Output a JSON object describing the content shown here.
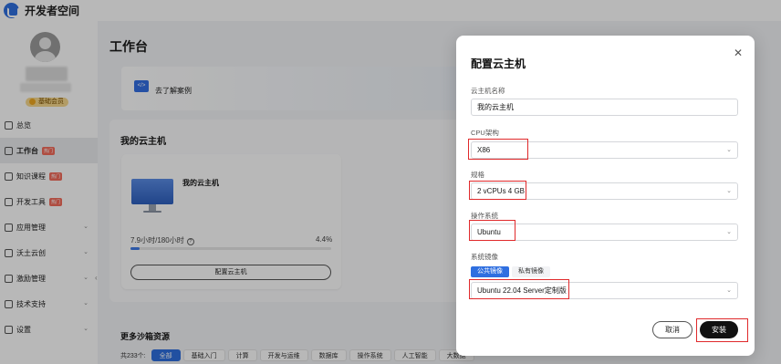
{
  "app": {
    "title": "开发者空间"
  },
  "sidebar": {
    "member_badge": "基础会员",
    "items": [
      {
        "label": "总览",
        "icon": "overview-icon",
        "tag": "",
        "chevron": false,
        "active": false
      },
      {
        "label": "工作台",
        "icon": "workbench-icon",
        "tag": "热门",
        "chevron": false,
        "active": true
      },
      {
        "label": "知识课程",
        "icon": "course-icon",
        "tag": "热门",
        "chevron": false,
        "active": false
      },
      {
        "label": "开发工具",
        "icon": "tools-icon",
        "tag": "热门",
        "chevron": false,
        "active": false
      },
      {
        "label": "应用管理",
        "icon": "app-icon",
        "tag": "",
        "chevron": true,
        "active": false
      },
      {
        "label": "沃土云创",
        "icon": "cloud-create-icon",
        "tag": "",
        "chevron": true,
        "active": false
      },
      {
        "label": "激励管理",
        "icon": "incentive-icon",
        "tag": "",
        "chevron": true,
        "active": false
      },
      {
        "label": "技术支持",
        "icon": "support-icon",
        "tag": "",
        "chevron": true,
        "active": false
      },
      {
        "label": "设置",
        "icon": "settings-icon",
        "tag": "",
        "chevron": true,
        "active": false
      }
    ]
  },
  "main": {
    "page_title": "工作台",
    "banner_text": "去了解案例",
    "cloud_section_title": "我的云主机",
    "card": {
      "name": "我的云主机",
      "usage": "7.9小时/180小时",
      "percent_text": "4.4%",
      "progress_fraction": 0.044,
      "config_button": "配置云主机"
    },
    "more_title": "更多沙箱资源",
    "filter_count": "共233个:",
    "chips": [
      "全部",
      "基础入门",
      "计算",
      "开发与运维",
      "数据库",
      "操作系统",
      "人工智能",
      "大数据"
    ]
  },
  "modal": {
    "title": "配置云主机",
    "name_label": "云主机名称",
    "name_value": "我的云主机",
    "cpu_label": "CPU架构",
    "cpu_value": "X86",
    "spec_label": "规格",
    "spec_value": "2 vCPUs 4 GB",
    "os_label": "操作系统",
    "os_value": "Ubuntu",
    "image_label": "系统镜像",
    "image_tabs": [
      "公共镜像",
      "私有镜像"
    ],
    "image_value": "Ubuntu 22.04 Server定制版",
    "cancel": "取消",
    "install": "安装"
  },
  "colors": {
    "accent": "#2f6fe0",
    "highlight": "#e0292b",
    "primary_button": "#111111"
  }
}
